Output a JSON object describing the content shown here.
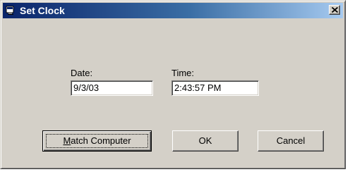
{
  "window": {
    "title": "Set Clock",
    "close_glyph": "✕",
    "icon": "app-icon"
  },
  "form": {
    "date_label": "Date:",
    "date_value": "9/3/03",
    "time_label": "Time:",
    "time_value": "2:43:57 PM"
  },
  "buttons": {
    "match_mnemonic": "M",
    "match_rest": "atch Computer",
    "ok": "OK",
    "cancel": "Cancel"
  },
  "colors": {
    "titlebar_start": "#0a246a",
    "titlebar_end": "#a6caf0",
    "face": "#d4d0c8"
  }
}
